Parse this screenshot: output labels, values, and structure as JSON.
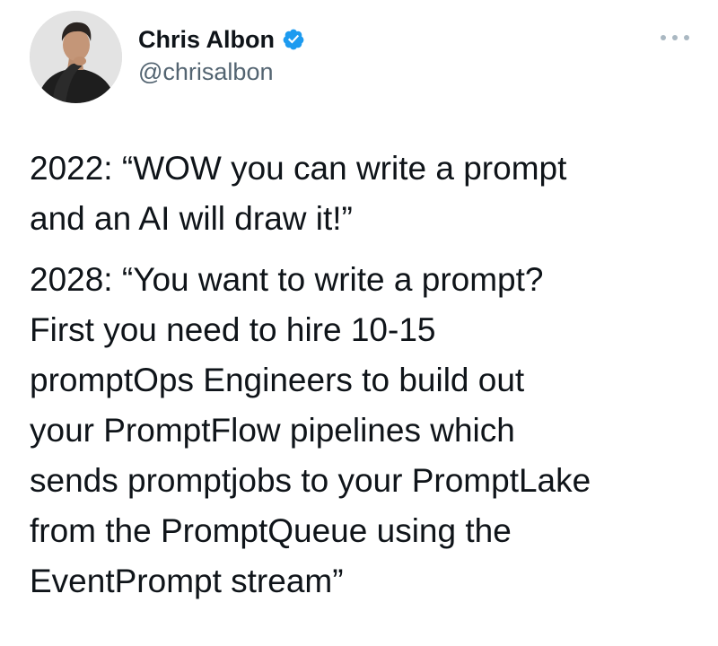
{
  "author": {
    "display_name": "Chris Albon",
    "handle": "@chrisalbon",
    "verified": true,
    "verified_color": "#1d9bf0",
    "avatar_icon": "profile-photo"
  },
  "menu": {
    "icon": "more-horizontal-icon"
  },
  "tweet": {
    "paragraphs": [
      "2022: “WOW you can write a prompt\nand an AI will draw it!”",
      "2028: “You want to write a prompt?\nFirst you need to hire 10-15\npromptOps Engineers to build out\nyour PromptFlow pipelines which\nsends promptjobs to your PromptLake\nfrom the PromptQueue using the\nEventPrompt stream”"
    ]
  },
  "colors": {
    "text": "#0f1419",
    "secondary_text": "#536471",
    "accent": "#1d9bf0",
    "background": "#ffffff"
  }
}
